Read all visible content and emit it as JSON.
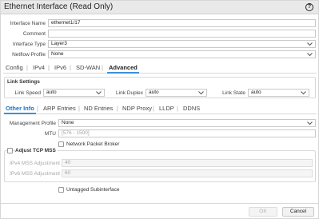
{
  "window": {
    "title": "Ethernet Interface (Read Only)",
    "help_glyph": "?"
  },
  "top_fields": {
    "interface_name": {
      "label": "Interface Name",
      "value": "ethernet1/17"
    },
    "comment": {
      "label": "Comment",
      "value": ""
    },
    "interface_type": {
      "label": "Interface Type",
      "value": "Layer3"
    },
    "netflow_profile": {
      "label": "Netflow Profile",
      "value": "None"
    }
  },
  "main_tabs": [
    {
      "label": "Config",
      "active": false
    },
    {
      "label": "IPv4",
      "active": false
    },
    {
      "label": "IPv6",
      "active": false
    },
    {
      "label": "SD-WAN",
      "active": false
    },
    {
      "label": "Advanced",
      "active": true
    }
  ],
  "link_settings": {
    "title": "Link Settings",
    "link_speed": {
      "label": "Link Speed",
      "value": "auto"
    },
    "link_duplex": {
      "label": "Link Duplex",
      "value": "auto"
    },
    "link_state": {
      "label": "Link State",
      "value": "auto"
    }
  },
  "sub_tabs": [
    {
      "label": "Other Info",
      "active": true
    },
    {
      "label": "ARP Entries",
      "active": false
    },
    {
      "label": "ND Entries",
      "active": false
    },
    {
      "label": "NDP Proxy",
      "active": false
    },
    {
      "label": "LLDP",
      "active": false
    },
    {
      "label": "DDNS",
      "active": false
    }
  ],
  "other_info": {
    "management_profile": {
      "label": "Management Profile",
      "value": "None"
    },
    "mtu": {
      "label": "MTU",
      "placeholder": "[576 - 1500]"
    },
    "network_packet_broker": {
      "label": "Network Packet Broker",
      "checked": false
    },
    "adjust_tcp_mss": {
      "label": "Adjust TCP MSS",
      "checked": false,
      "ipv4_label": "IPv4 MSS Adjustment",
      "ipv4_value": "40",
      "ipv6_label": "IPv6 MSS Adjustment",
      "ipv6_value": "60"
    },
    "untagged_subinterface": {
      "label": "Untagged Subinterface",
      "checked": false
    }
  },
  "buttons": {
    "ok": "OK",
    "cancel": "Cancel"
  },
  "colors": {
    "accent": "#3d8fd6",
    "tab_active_blue": "#1a73c8",
    "titlebar": "#e9e9e9"
  }
}
